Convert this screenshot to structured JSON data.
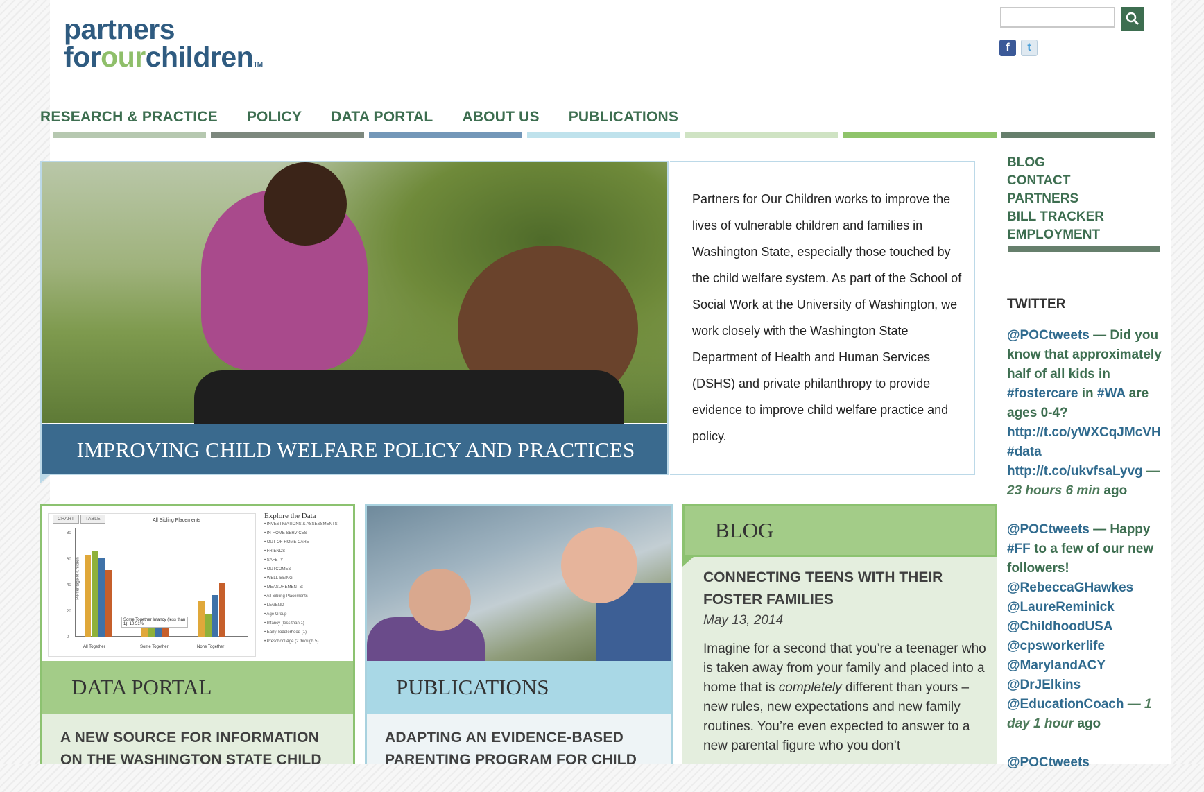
{
  "logo": {
    "line1": "partners",
    "line2_pre": "for",
    "line2_our": "our",
    "line2_post": "children",
    "tm": "TM"
  },
  "search": {
    "placeholder": ""
  },
  "social": {
    "facebook": "f",
    "twitter": "t"
  },
  "nav": [
    "RESEARCH & PRACTICE",
    "POLICY",
    "DATA PORTAL",
    "ABOUT US",
    "PUBLICATIONS"
  ],
  "nav_bar_colors": [
    "#b6c8b0",
    "#7d887e",
    "#7397b8",
    "#bfe2ec",
    "#cfe3c3",
    "#8fc46a",
    "#667f6c"
  ],
  "hero": {
    "banner": "IMPROVING CHILD WELFARE POLICY AND PRACTICES",
    "intro": "Partners for Our Children works to improve the lives of vulnerable children and families in Washington State, especially those touched by the child welfare system. As part of the School of Social Work at the University of Washington, we work closely with the Washington State Department of Health and Human Services (DSHS) and private philanthropy to provide evidence to improve child welfare practice and policy."
  },
  "sidebar": {
    "links": [
      "BLOG",
      "CONTACT",
      "PARTNERS",
      "BILL TRACKER",
      "EMPLOYMENT"
    ],
    "twitter_heading": "TWITTER",
    "tweet1": {
      "handle": "@POCtweets",
      "dash": "—",
      "text1": "Did you know that approximately half of all kids in",
      "tag1": "#fostercare",
      "text2": "in",
      "tag2": "#WA",
      "text3": "are ages 0-4?",
      "link1": "http://t.co/yWXCqJMcVH",
      "tag3": "#data",
      "link2": "http://t.co/ukvfsaLyvg",
      "time": "— 23 hours 6 min",
      "ago": "ago"
    },
    "tweet2": {
      "handle": "@POCtweets",
      "dash": "—",
      "text1": "Happy",
      "tag1": "#FF",
      "text2": "to a few of our new followers!",
      "m1": "@RebeccaGHawkes",
      "m2": "@LaureReminick",
      "m3": "@ChildhoodUSA",
      "m4": "@cpsworkerlife",
      "m5": "@MarylandACY",
      "m6": "@DrJElkins",
      "m7": "@EducationCoach",
      "time": "— 1 day 1 hour",
      "ago": "ago"
    },
    "tweet3_partial": "@POCtweets"
  },
  "cards": {
    "data_portal": {
      "title": "DATA PORTAL",
      "body": "A NEW SOURCE FOR INFORMATION ON THE WASHINGTON STATE CHILD"
    },
    "publications": {
      "title": "PUBLICATIONS",
      "body": "ADAPTING AN EVIDENCE-BASED PARENTING PROGRAM FOR CHILD"
    }
  },
  "chart_thumb": {
    "tabs": [
      "CHART",
      "TABLE"
    ],
    "title": "All Sibling Placements",
    "ylabel": "Percentage of Children",
    "yticks": [
      "80",
      "60",
      "40",
      "20",
      "0"
    ],
    "annotation": "Some Together Infancy (less than 1): 10.51%",
    "explore_title": "Explore the Data",
    "explore_opts": [
      "INVESTIGATIONS & ASSESSMENTS",
      "IN-HOME SERVICES",
      "OUT-OF-HOME CARE",
      "FRIENDS",
      "SAFETY",
      "OUTCOMES",
      "WELL-BEING",
      "MEASUREMENTS:",
      "All Sibling Placements",
      "LEGEND",
      "Age Group",
      "Infancy (less than 1)",
      "Early Toddlerhood (1)",
      "Preschool Age (2 through 5)"
    ]
  },
  "chart_data": {
    "type": "bar",
    "categories": [
      "All Together",
      "Some Together",
      "None Together"
    ],
    "series": [
      {
        "name": "Infancy (less than 1)",
        "values": [
          63,
          10.5,
          27
        ]
      },
      {
        "name": "Early Toddlerhood (1)",
        "values": [
          66,
          12,
          17
        ]
      },
      {
        "name": "Preschool Age (2 through 5)",
        "values": [
          61,
          13,
          32
        ]
      },
      {
        "name": "Age Group",
        "values": [
          51,
          12,
          41
        ]
      }
    ],
    "ylabel": "Percentage of Children",
    "ylim": [
      0,
      80
    ]
  },
  "blog": {
    "heading": "BLOG",
    "title": "CONNECTING TEENS WITH THEIR FOSTER FAMILIES",
    "date": "May 13, 2014",
    "excerpt_pre": "Imagine for a second that you’re a teenager who is taken away from your family and placed into a home that is ",
    "excerpt_em": "completely",
    "excerpt_post": " different than yours – new rules, new expectations and new family routines. You’re even expected to answer to a new parental figure who you don’t"
  }
}
